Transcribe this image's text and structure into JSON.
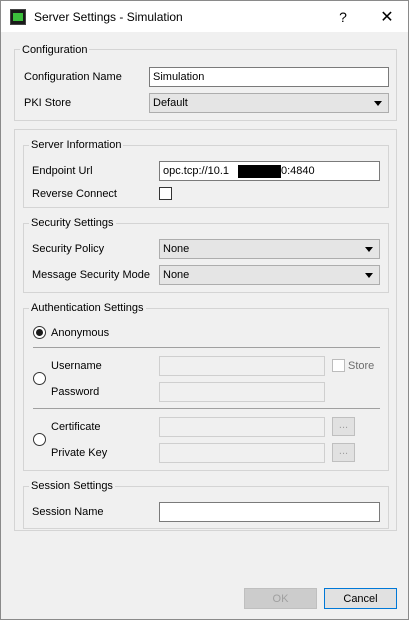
{
  "window": {
    "title": "Server Settings - Simulation",
    "help_glyph": "?",
    "close_glyph": "✕"
  },
  "configuration": {
    "group_title": "Configuration",
    "name_label": "Configuration Name",
    "name_value": "Simulation",
    "pki_label": "PKI Store",
    "pki_value": "Default"
  },
  "server_information": {
    "group_title": "Server Information",
    "endpoint_label": "Endpoint Url",
    "endpoint_prefix": "opc.tcp://10.1",
    "endpoint_suffix": "0:4840",
    "reverse_connect_label": "Reverse Connect",
    "reverse_connect_checked": false
  },
  "security_settings": {
    "group_title": "Security Settings",
    "policy_label": "Security Policy",
    "policy_value": "None",
    "mode_label": "Message Security Mode",
    "mode_value": "None"
  },
  "authentication": {
    "group_title": "Authentication Settings",
    "anonymous_label": "Anonymous",
    "username_label": "Username",
    "password_label": "Password",
    "store_label": "Store",
    "certificate_label": "Certificate",
    "private_key_label": "Private Key",
    "browse_label": "...",
    "selected": "Anonymous"
  },
  "session": {
    "group_title": "Session Settings",
    "name_label": "Session Name",
    "name_value": ""
  },
  "footer": {
    "ok_label": "OK",
    "cancel_label": "Cancel"
  }
}
